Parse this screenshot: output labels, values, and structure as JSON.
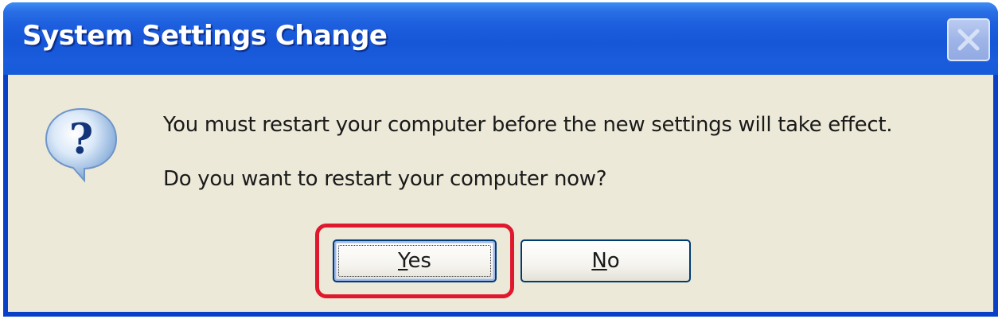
{
  "dialog": {
    "title": "System Settings Change",
    "icon": "question-icon",
    "message_line1": "You must restart your computer before the new settings will take effect.",
    "message_line2": "Do you want to restart your computer now?",
    "buttons": {
      "yes_label": "Yes",
      "no_label": "No"
    },
    "focused_button": "Yes",
    "highlighted_button": "Yes"
  },
  "colors": {
    "titlebar": "#1656d8",
    "client_background": "#ece9d8",
    "highlight_annotation": "#e0182d"
  }
}
